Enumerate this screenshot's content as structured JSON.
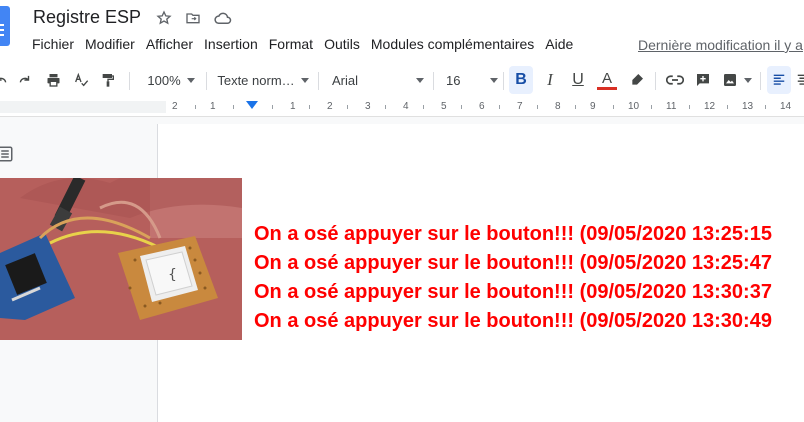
{
  "header": {
    "title": "Registre ESP",
    "last_modified": "Dernière modification il y a"
  },
  "menu": [
    "Fichier",
    "Modifier",
    "Afficher",
    "Insertion",
    "Format",
    "Outils",
    "Modules complémentaires",
    "Aide"
  ],
  "toolbar": {
    "zoom": "100%",
    "style": "Texte norm…",
    "font": "Arial",
    "font_size": "16",
    "text_color": "#d93025",
    "bold_label": "B",
    "italic_label": "I",
    "underline_label": "U",
    "text_color_label": "A"
  },
  "ruler": {
    "numbers": [
      "2",
      "1",
      "1",
      "2",
      "3",
      "4",
      "5",
      "6",
      "7",
      "8",
      "9",
      "10",
      "11",
      "12",
      "13",
      "14"
    ]
  },
  "document": {
    "lines": [
      "On a osé appuyer sur le bouton!!! (09/05/2020 13:25:15",
      "On a osé appuyer sur le bouton!!! (09/05/2020 13:25:47",
      "On a osé appuyer sur le bouton!!! (09/05/2020 13:30:37",
      "On a osé appuyer sur le bouton!!! (09/05/2020 13:30:49"
    ],
    "text_color": "#ff0000"
  }
}
